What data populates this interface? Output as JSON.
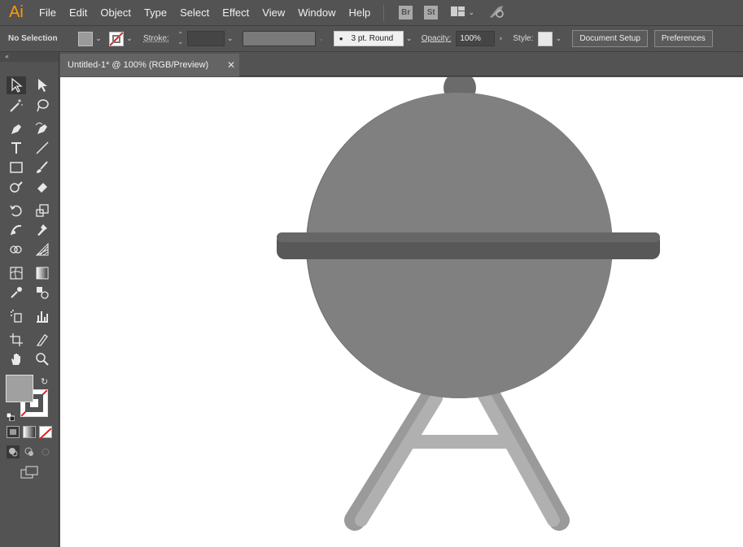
{
  "app": {
    "logo": "Ai"
  },
  "menu": [
    "File",
    "Edit",
    "Object",
    "Type",
    "Select",
    "Effect",
    "View",
    "Window",
    "Help"
  ],
  "menu_badges": {
    "bridge": "Br",
    "stock": "St"
  },
  "control_bar": {
    "selection": "No Selection",
    "stroke_label": "Stroke:",
    "brush_value": "3 pt. Round",
    "opacity_label": "Opacity:",
    "opacity_value": "100%",
    "style_label": "Style:",
    "document_setup": "Document Setup",
    "preferences": "Preferences"
  },
  "document_tab": {
    "title": "Untitled-1* @ 100% (RGB/Preview)"
  },
  "icons": {
    "menu": [
      "bridge-icon",
      "stock-icon",
      "workspace-icon",
      "chevron-down-icon",
      "gpu-rocket-icon"
    ],
    "tools": [
      "selection-icon",
      "direct-selection-icon",
      "magic-wand-icon",
      "lasso-icon",
      "pen-icon",
      "curvature-icon",
      "type-icon",
      "line-icon",
      "rectangle-icon",
      "paintbrush-icon",
      "shaper-icon",
      "eraser-icon",
      "rotate-icon",
      "scale-icon",
      "warp-icon",
      "puppet-warp-icon",
      "shape-builder-icon",
      "perspective-grid-icon",
      "mesh-icon",
      "gradient-icon",
      "eyedropper-icon",
      "blend-icon",
      "symbol-sprayer-icon",
      "column-graph-icon",
      "artboard-icon",
      "slice-icon",
      "hand-icon",
      "zoom-icon",
      "fill-swatch",
      "stroke-swatch",
      "swap-icon",
      "default-colors-icon",
      "color-mode-icon",
      "gradient-mode-icon",
      "none-mode-icon",
      "draw-normal-icon",
      "draw-behind-icon",
      "draw-inside-icon",
      "screen-mode-icon"
    ]
  },
  "colors": {
    "ui_bg": "#535353",
    "canvas": "#ffffff",
    "fill": "#a0a0a0",
    "lid_front": "#808080",
    "lid_shadow": "#6b6b6b",
    "handle_bar": "#585858",
    "legs": "#b0b0b0",
    "legs_shadow": "#9a9a9a"
  }
}
